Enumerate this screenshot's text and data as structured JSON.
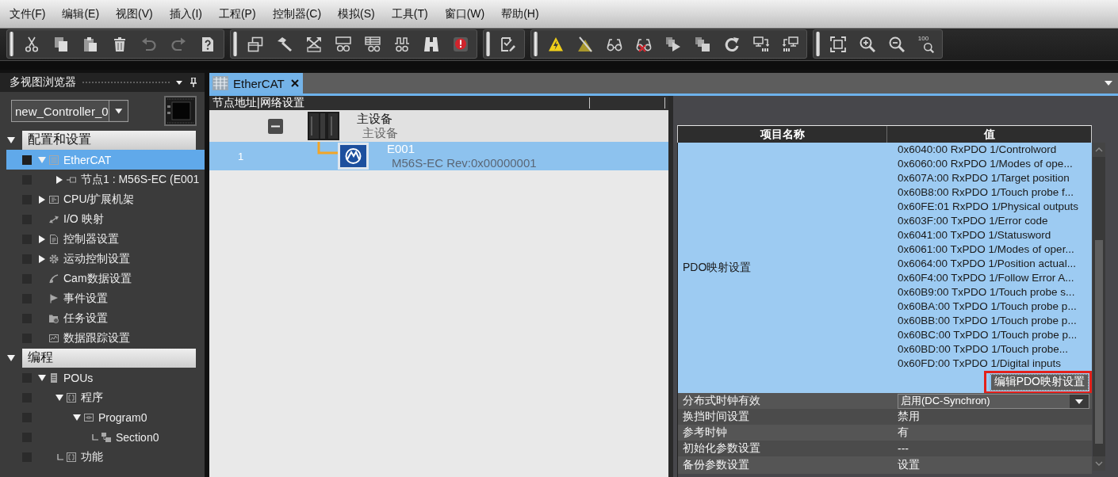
{
  "menu": [
    "文件(F)",
    "编辑(E)",
    "视图(V)",
    "插入(I)",
    "工程(P)",
    "控制器(C)",
    "模拟(S)",
    "工具(T)",
    "窗口(W)",
    "帮助(H)"
  ],
  "toolbar": {
    "groups": [
      {
        "buttons": [
          {
            "disabled": false
          },
          {
            "disabled": false
          },
          {
            "disabled": false
          },
          {
            "disabled": false
          },
          {
            "disabled": true
          },
          {
            "disabled": true
          },
          {
            "disabled": false
          }
        ]
      },
      {
        "buttons": [
          {
            "disabled": false
          },
          {
            "disabled": false
          },
          {
            "disabled": false
          },
          {
            "disabled": false
          },
          {
            "disabled": false
          },
          {
            "disabled": false
          },
          {
            "disabled": false
          },
          {
            "disabled": false
          }
        ]
      },
      {
        "buttons": [
          {
            "disabled": false
          }
        ]
      },
      {
        "buttons": [
          {
            "disabled": false
          },
          {
            "disabled": false
          },
          {
            "disabled": false
          },
          {
            "disabled": false
          },
          {
            "disabled": false
          },
          {
            "disabled": false
          },
          {
            "disabled": false
          },
          {
            "disabled": false
          },
          {
            "disabled": false
          }
        ]
      },
      {
        "buttons": [
          {
            "disabled": false
          },
          {
            "disabled": false
          },
          {
            "disabled": false
          },
          {
            "disabled": false,
            "label": "100"
          }
        ]
      }
    ]
  },
  "sidebar": {
    "title": "多视图浏览器",
    "controller": "new_Controller_0",
    "sections": [
      {
        "label": "配置和设置",
        "expanded": true,
        "items": [
          {
            "label": "EtherCAT",
            "kind": "node",
            "expanded": true,
            "selected": true,
            "children": [
              {
                "label": "节点1 : M56S-EC (E001",
                "kind": "node",
                "expanded": false,
                "selected": false
              }
            ]
          },
          {
            "label": "CPU/扩展机架",
            "kind": "node",
            "expanded": false,
            "selected": false
          },
          {
            "label": "I/O 映射",
            "kind": "leaf",
            "selected": false
          },
          {
            "label": "控制器设置",
            "kind": "node",
            "expanded": false,
            "selected": false
          },
          {
            "label": "运动控制设置",
            "kind": "node",
            "expanded": false,
            "selected": false
          },
          {
            "label": "Cam数据设置",
            "kind": "leaf",
            "selected": false
          },
          {
            "label": "事件设置",
            "kind": "leaf",
            "selected": false
          },
          {
            "label": "任务设置",
            "kind": "leaf",
            "selected": false
          },
          {
            "label": "数据跟踪设置",
            "kind": "leaf",
            "selected": false
          }
        ]
      },
      {
        "label": "编程",
        "expanded": true,
        "items": [
          {
            "label": "POUs",
            "kind": "node",
            "expanded": true,
            "selected": false,
            "children": [
              {
                "label": "程序",
                "kind": "node",
                "expanded": true,
                "selected": false,
                "children": [
                  {
                    "label": "Program0",
                    "kind": "node",
                    "expanded": true,
                    "selected": false,
                    "children": [
                      {
                        "label": "Section0",
                        "kind": "end",
                        "selected": false
                      }
                    ]
                  }
                ]
              },
              {
                "label": "功能",
                "kind": "end",
                "selected": false
              }
            ]
          }
        ]
      }
    ]
  },
  "tabs": [
    {
      "label": "EtherCAT",
      "selected": true
    }
  ],
  "network": {
    "header": "节点地址|网络设置",
    "master": {
      "name": "主设备",
      "subtitle": "主设备",
      "expanded": true
    },
    "nodes": [
      {
        "address": "1",
        "name": "E001",
        "subtitle": "M56S-EC Rev:0x00000001",
        "selected": true
      }
    ]
  },
  "properties": {
    "columns": [
      "项目名称",
      "值"
    ],
    "rows": [
      {
        "kind": "list",
        "name": "PDO映射设置",
        "selected": true,
        "values": [
          "0x6040:00 RxPDO 1/Controlword",
          "0x6060:00 RxPDO 1/Modes of ope...",
          "0x607A:00 RxPDO 1/Target position",
          "0x60B8:00 RxPDO 1/Touch probe f...",
          "0x60FE:01 RxPDO 1/Physical outputs",
          "0x603F:00 TxPDO 1/Error code",
          "0x6041:00 TxPDO 1/Statusword",
          "0x6061:00 TxPDO 1/Modes of oper...",
          "0x6064:00 TxPDO 1/Position actual...",
          "0x60F4:00 TxPDO 1/Follow Error A...",
          "0x60B9:00 TxPDO 1/Touch probe s...",
          "0x60BA:00 TxPDO 1/Touch probe p...",
          "0x60BB:00 TxPDO 1/Touch probe p...",
          "0x60BC:00 TxPDO 1/Touch probe p...",
          "0x60BD:00 TxPDO 1/Touch probe...",
          "0x60FD:00 TxPDO 1/Digital inputs"
        ],
        "button": {
          "label": "编辑PDO映射设置",
          "highlighted": true
        }
      },
      {
        "kind": "dropdown",
        "name": "分布式时钟有效",
        "selected": false,
        "value": "启用(DC-Synchron)"
      },
      {
        "kind": "text",
        "name": "换挡时间设置",
        "selected": false,
        "value": "禁用"
      },
      {
        "kind": "text",
        "name": "参考时钟",
        "selected": false,
        "value": "有"
      },
      {
        "kind": "text",
        "name": "初始化参数设置",
        "selected": false,
        "value": "---"
      },
      {
        "kind": "text",
        "name": "备份参数设置",
        "selected": false,
        "value": "设置"
      }
    ]
  }
}
